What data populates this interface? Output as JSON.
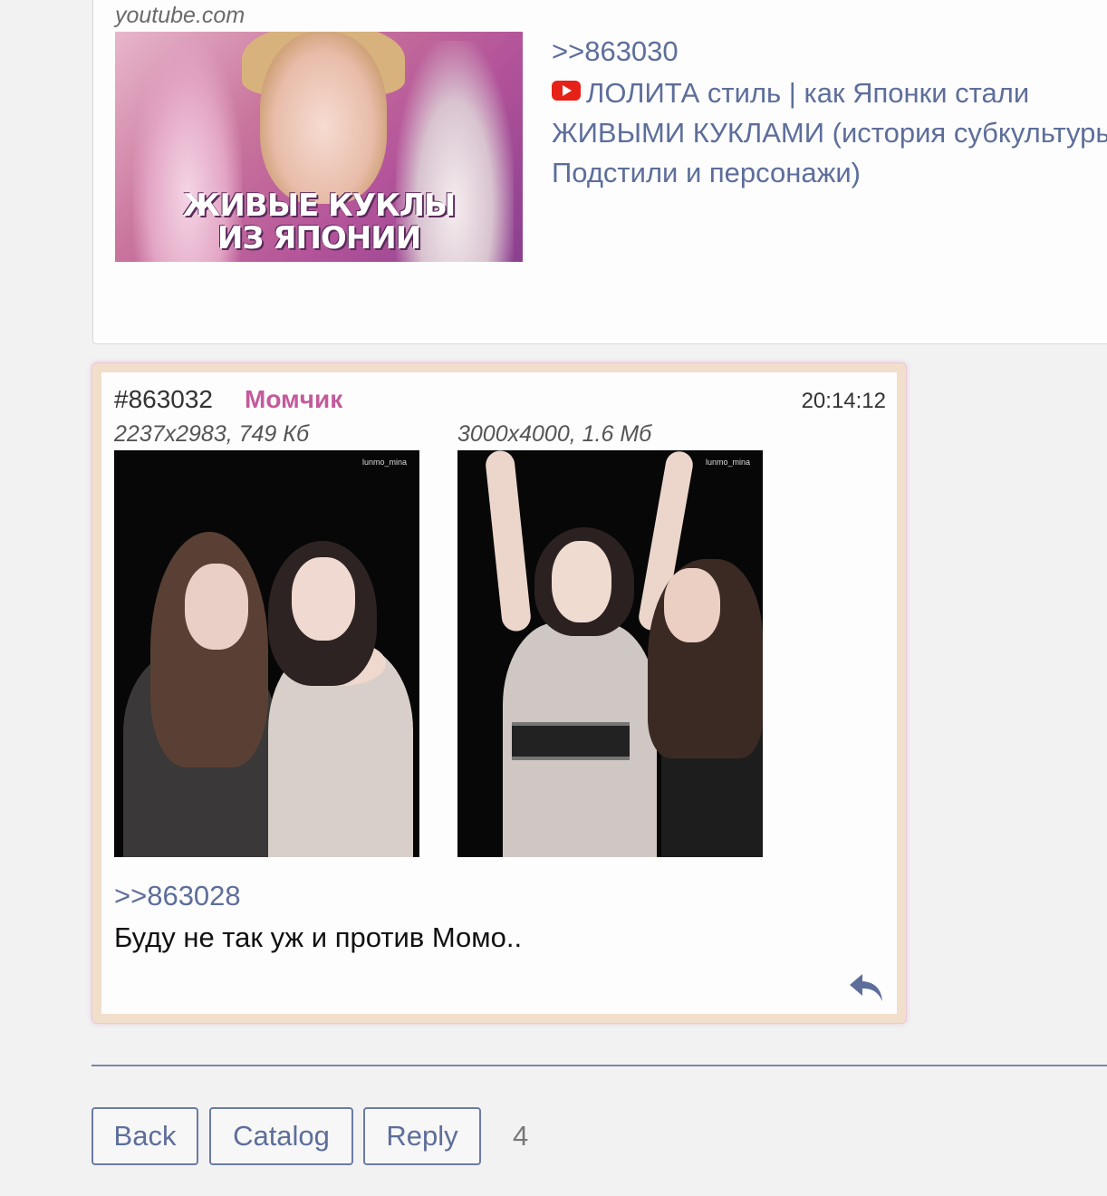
{
  "previous_post": {
    "embed_source": "youtube.com",
    "thumbnail_title_line1": "ЖИВЫЕ КУКЛЫ",
    "thumbnail_title_line2": "ИЗ ЯПОНИИ",
    "reply_ref": ">>863030",
    "video_title": "ЛОЛИТА стиль | как Японки стали ЖИВЫМИ КУКЛАМИ (история субкультуры; Подстили и персонажи)",
    "video_icon": "youtube-icon"
  },
  "post": {
    "number": "#863032",
    "author": "Момчик",
    "time": "20:14:12",
    "files": [
      {
        "meta": "2237x2983, 749 Кб",
        "watermark": "lunmo_mina"
      },
      {
        "meta": "3000x4000, 1.6 Мб",
        "watermark": "lunmo_mina"
      }
    ],
    "reply_ref": ">>863028",
    "text": "Буду не так уж и против Момо..",
    "reply_icon": "reply-arrow-icon"
  },
  "footer": {
    "back_label": "Back",
    "catalog_label": "Catalog",
    "reply_label": "Reply",
    "count": "4"
  },
  "colors": {
    "link": "#5d6e9b",
    "author": "#c45a9c",
    "post_frame": "#f1dfcb",
    "youtube_red": "#e62117"
  }
}
